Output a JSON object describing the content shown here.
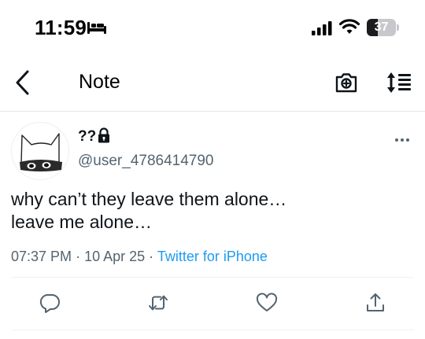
{
  "status_bar": {
    "time": "11:59",
    "battery_level": "37",
    "battery_fraction": 0.37,
    "icons": [
      "bed-icon",
      "cellular-signal-icon",
      "wifi-icon",
      "battery-icon"
    ]
  },
  "nav": {
    "title": "Note",
    "back_icon": "chevron-left-icon",
    "camera_icon": "camera-icon",
    "text_size_icon": "text-size-icon"
  },
  "tweet": {
    "display_name": "??",
    "protected_icon": "lock-icon",
    "handle": "@user_4786414790",
    "text_lines": [
      "why can’t they leave them alone…",
      "leave me alone…"
    ],
    "time": "07:37 PM",
    "separator": "·",
    "date": "10 Apr 25",
    "source": "Twitter for iPhone",
    "actions": [
      "reply-icon",
      "retweet-icon",
      "like-icon",
      "share-icon"
    ]
  },
  "colors": {
    "text": "#0f1419",
    "secondary": "#536471",
    "link": "#1d9bf0",
    "icon": "#536471"
  }
}
